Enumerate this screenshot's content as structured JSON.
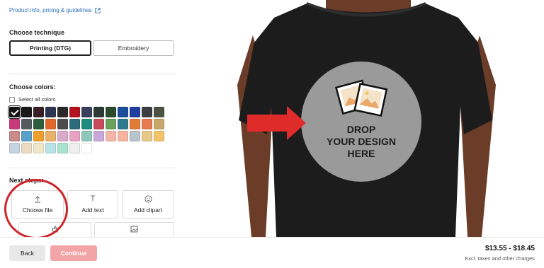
{
  "left_panel": {
    "guidelines_link": "Product info, pricing & guidelines",
    "technique_heading": "Choose technique",
    "techniques": [
      {
        "label": "Printing (DTG)",
        "selected": true
      },
      {
        "label": "Embroidery",
        "selected": false
      }
    ],
    "colors_heading": "Choose colors:",
    "select_all_label": "Select all colors",
    "swatches": [
      "#111111",
      "#1a1a1a",
      "#3a1f24",
      "#2b3550",
      "#2a2a2a",
      "#b3121f",
      "#3a3f5a",
      "#2c3a35",
      "#2d4a2c",
      "#1d4e9c",
      "#1f3fa0",
      "#3b3f44",
      "#4a5440",
      "#c93a7a",
      "#555a5e",
      "#2f5e3d",
      "#e0672a",
      "#4c4c4c",
      "#2d6a7a",
      "#1f8a7e",
      "#c74b5a",
      "#6ba05b",
      "#2f7a8c",
      "#e27c3a",
      "#e67a52",
      "#c7a86a",
      "#c98a8a",
      "#5aa0c8",
      "#f0a02a",
      "#e8b26a",
      "#d9a9c9",
      "#e9a1c4",
      "#8fc7b9",
      "#c8a8d8",
      "#f3b6a6",
      "#f5b3a0",
      "#b9c3cc",
      "#e8c98a",
      "#f2c46a",
      "#c5d3e2",
      "#e9dcc0",
      "#f1e6c8",
      "#b9e3e6",
      "#a9e3cf",
      "#eeeeee",
      "#ffffff"
    ],
    "next_steps_heading": "Next steps:",
    "actions": [
      {
        "label": "Choose file",
        "icon": "upload-icon"
      },
      {
        "label": "Add text",
        "icon": "text-icon"
      },
      {
        "label": "Add clipart",
        "icon": "smiley-icon"
      }
    ]
  },
  "preview": {
    "drop_text_line1": "DROP",
    "drop_text_line2": "YOUR DESIGN",
    "drop_text_line3": "HERE",
    "accent_arrow": "#e02b2b"
  },
  "footer": {
    "back_label": "Back",
    "continue_label": "Continue",
    "price": "$13.55 - $18.45",
    "price_note": "Excl. taxes and other charges"
  }
}
